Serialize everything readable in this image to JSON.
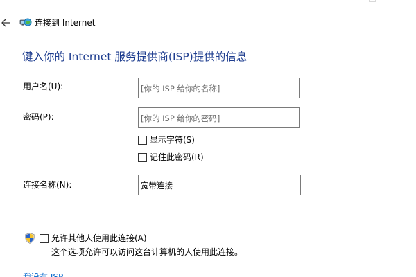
{
  "window": {
    "title": "连接到 Internet",
    "caption_minimize_glyph": "—",
    "caption_maximize_glyph": "□",
    "caption_close_glyph": "×"
  },
  "header": {
    "back_icon": "back-arrow-icon",
    "title_icon": "network-globe-icon"
  },
  "form": {
    "heading": "键入你的 Internet 服务提供商(ISP)提供的信息",
    "username": {
      "label": "用户名(U):",
      "value": "",
      "placeholder": "[你的 ISP 给你的名称]"
    },
    "password": {
      "label": "密码(P):",
      "value": "",
      "placeholder": "[你的 ISP 给你的密码]"
    },
    "show_chars": {
      "label": "显示字符(S)",
      "checked": false
    },
    "remember_password": {
      "label": "记住此密码(R)",
      "checked": false
    },
    "connection_name": {
      "label": "连接名称(N):",
      "value": "宽带连接"
    },
    "allow_others": {
      "label": "允许其他人使用此连接(A)",
      "checked": false,
      "icon": "uac-shield-icon",
      "description": "这个选项允许可以访问这台计算机的人使用此连接。"
    },
    "no_isp_link": "我没有 ISP"
  },
  "colors": {
    "heading": "#1e3d8f",
    "link": "#0066cc",
    "textbox_border": "#7a7a7a",
    "placeholder": "#6d6d6d"
  }
}
